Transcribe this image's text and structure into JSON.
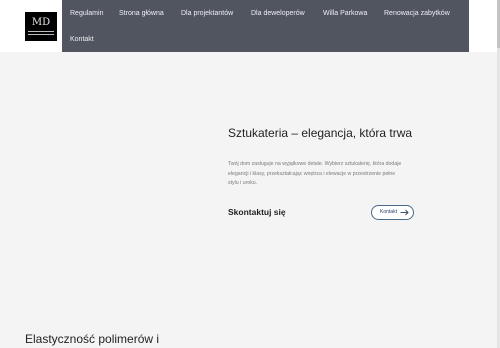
{
  "header": {
    "logo_text": "MD",
    "nav": [
      {
        "label": "Regulamin"
      },
      {
        "label": "Strona główna"
      },
      {
        "label": "Dla projektantów"
      },
      {
        "label": "Dla deweloperów"
      },
      {
        "label": "Willa Parkowa"
      },
      {
        "label": "Renowacja zabytków"
      },
      {
        "label": "Kontakt"
      }
    ]
  },
  "hero": {
    "title": "Sztukateria – elegancja, która trwa",
    "description": "Twój dom zasługuje na wyjątkowe detale. Wybierz sztukaterię, która dodaje elegancji i klasy, przekształcając wnętrza i elewacje w przestrzenie pełne stylu i uroku.",
    "contact_heading": "Skontaktuj się",
    "contact_button": "Kontakt"
  },
  "section": {
    "title": "Elastyczność polimerów i"
  },
  "colors": {
    "nav_bg": "#505560",
    "hero_bg": "#f4f4f4",
    "button_border": "#4a6a8a",
    "button_text": "#2a3f66"
  },
  "icons": {
    "contact_button_icon": "arrow-right-icon"
  }
}
